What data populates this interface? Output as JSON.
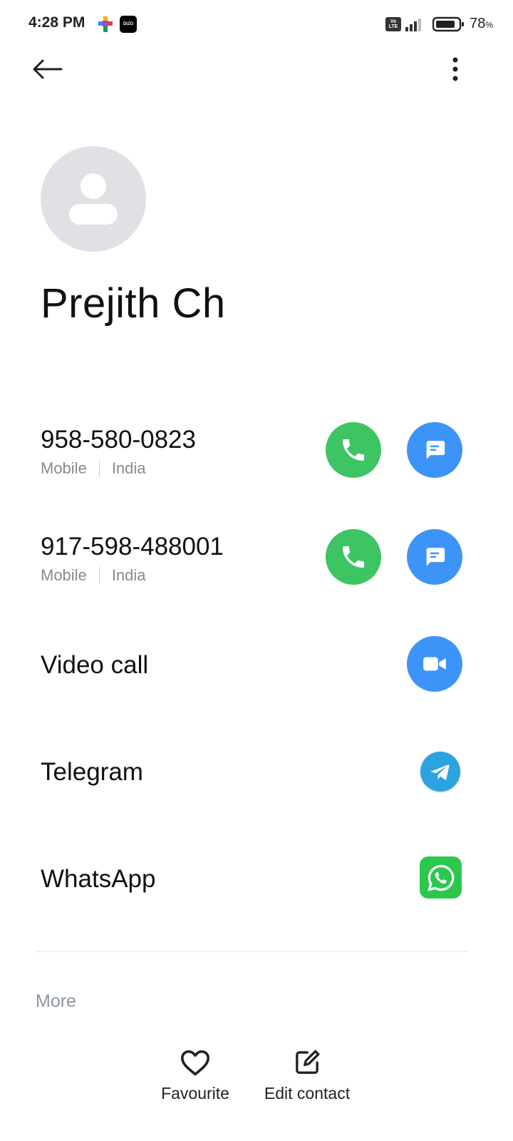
{
  "status_bar": {
    "time": "4:28 PM",
    "notif_app_2": "DIZO",
    "volte": "Vo LTE",
    "battery_percent": "78",
    "battery_unit": "%"
  },
  "contact": {
    "name": "Prejith Ch"
  },
  "phones": [
    {
      "number": "958-580-0823",
      "type": "Mobile",
      "region": "India"
    },
    {
      "number": "917-598-488001",
      "type": "Mobile",
      "region": "India"
    }
  ],
  "actions": {
    "video_call": "Video call",
    "telegram": "Telegram",
    "whatsapp": "WhatsApp"
  },
  "more_label": "More",
  "bottom_bar": {
    "favourite": "Favourite",
    "edit_contact": "Edit contact"
  },
  "colors": {
    "call_green": "#3cc562",
    "message_blue": "#3d94f8",
    "telegram_blue": "#2aa3e0",
    "whatsapp_green": "#2cc84d",
    "avatar_bg": "#dfe1e4"
  },
  "icons": {
    "back": "arrow-left-icon",
    "overflow": "more-vertical-icon",
    "call": "phone-icon",
    "message": "message-icon",
    "video": "video-camera-icon",
    "telegram": "telegram-icon",
    "whatsapp": "whatsapp-icon",
    "favourite": "heart-icon",
    "edit": "edit-icon"
  }
}
